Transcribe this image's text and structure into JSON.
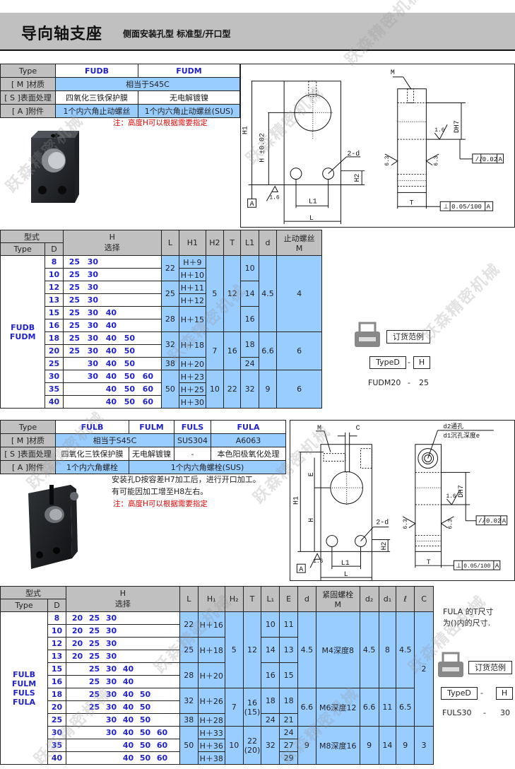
{
  "header": {
    "title": "导向轴支座",
    "subtitle": "侧面安装孔型 标准型/开口型"
  },
  "section1": {
    "spec": {
      "type_label": "Type",
      "types": [
        "FUDB",
        "FUDM"
      ],
      "material_label": "[ M ]材质",
      "material": "相当于S45C",
      "surface_label": "[ S ]表面处理",
      "surface": [
        "四氧化三铁保护膜",
        "无电解镀镍"
      ],
      "accessory_label": "[ A ]附件",
      "accessory": [
        "1个内六角止动螺丝",
        "1个内六角止动螺丝(SUS)"
      ]
    },
    "note_red": "注：高度H可以根据需要指定",
    "drawing_labels": {
      "H1": "H1",
      "H": "H ±0.02",
      "d2": "2-d",
      "H2": "H2",
      "L1": "L1",
      "L": "L",
      "A": "A",
      "M": "M",
      "DH7": "DH7",
      "T": "T",
      "r16": "1.6",
      "r63": "6.3",
      "parallel": "0.02",
      "perp": "0.05/100"
    },
    "table": {
      "headers": {
        "model": "型式",
        "type": "Type",
        "d": "D",
        "h": "H",
        "h_sub": "选择",
        "L": "L",
        "H1": "H1",
        "H2": "H2",
        "T": "T",
        "L1": "L1",
        "dcol": "d",
        "m": "止动螺丝",
        "m_sub": "M"
      },
      "type_names": [
        "FUDB",
        "FUDM"
      ],
      "rows": [
        {
          "D": "8",
          "H": [
            "25",
            "30",
            "",
            "",
            ""
          ]
        },
        {
          "D": "10",
          "H": [
            "25",
            "30",
            "",
            "",
            ""
          ]
        },
        {
          "D": "12",
          "H": [
            "25",
            "30",
            "",
            "",
            ""
          ]
        },
        {
          "D": "13",
          "H": [
            "25",
            "30",
            "",
            "",
            ""
          ]
        },
        {
          "D": "15",
          "H": [
            "25",
            "30",
            "40",
            "",
            ""
          ]
        },
        {
          "D": "16",
          "H": [
            "25",
            "30",
            "40",
            "",
            ""
          ]
        },
        {
          "D": "18",
          "H": [
            "25",
            "30",
            "40",
            "50",
            ""
          ]
        },
        {
          "D": "20",
          "H": [
            "25",
            "30",
            "40",
            "50",
            ""
          ]
        },
        {
          "D": "25",
          "H": [
            "",
            "30",
            "40",
            "50",
            ""
          ]
        },
        {
          "D": "30",
          "H": [
            "",
            "30",
            "40",
            "50",
            "60"
          ]
        },
        {
          "D": "35",
          "H": [
            "",
            "",
            "40",
            "50",
            "60"
          ]
        },
        {
          "D": "40",
          "H": [
            "",
            "",
            "40",
            "50",
            "60"
          ]
        }
      ],
      "L": [
        "22",
        "25",
        "28",
        "32",
        "38",
        "50"
      ],
      "H1": [
        "H＋9",
        "H＋10",
        "H＋11",
        "H＋12",
        "H＋15",
        "H＋18",
        "H＋20",
        "H＋23",
        "H＋25",
        "H＋30"
      ],
      "H2": [
        "5",
        "7",
        "10"
      ],
      "T": [
        "12",
        "16",
        "22"
      ],
      "L1": [
        "10",
        "14",
        "16",
        "18",
        "24",
        "32"
      ],
      "d": [
        "4.5",
        "6.6",
        "9"
      ],
      "M": [
        "4",
        "6",
        "6"
      ]
    },
    "order": {
      "title": "订货范例",
      "box1": "TypeD",
      "dash": "-",
      "box2": "H",
      "example_code": "FUDM20",
      "example_dash": "-",
      "example_h": "25"
    }
  },
  "section2": {
    "spec": {
      "type_label": "Type",
      "types": [
        "FULB",
        "FULM",
        "FULS",
        "FULA"
      ],
      "material_label": "[ M ]材质",
      "material": [
        "相当于S45C",
        "SUS304",
        "A6063"
      ],
      "surface_label": "[ S ]表面处理",
      "surface": [
        "四氧化三铁保护膜",
        "无电解镀镍",
        "-",
        "本色阳极氧化处理"
      ],
      "accessory_label": "[ A ]附件",
      "accessory": [
        "1个内六角螺栓",
        "1个内六角螺栓(SUS)"
      ]
    },
    "note_lines": [
      "安装孔D按容差H7加工后，进行开口加工。",
      "有可能因加工增至H8左右。"
    ],
    "note_red": "注：高度H可以根据需要指定",
    "drawing_labels": {
      "M": "M",
      "C": "C",
      "E": "E",
      "H1": "H1",
      "H": "H",
      "d2": "2-d",
      "H2": "H2",
      "L1": "L1",
      "L": "L",
      "A": "A",
      "hole1": "d2通孔",
      "hole2": "d1沉孔深度e",
      "DH7": "DH7",
      "T": "T",
      "r16": "1.6",
      "r63": "6.3",
      "parallel": "0.02",
      "perp": "0.05/100"
    },
    "table": {
      "headers": {
        "model": "型式",
        "type": "Type",
        "d": "D",
        "h": "H",
        "h_sub": "选择",
        "L": "L",
        "H1": "H₁",
        "H2": "H₂",
        "T": "T",
        "L1": "L₁",
        "E": "E",
        "dcol": "d",
        "m": "紧固螺栓",
        "m_sub": "M",
        "d2": "d₂",
        "d1": "d₁",
        "l": "ℓ",
        "C": "C"
      },
      "type_names": [
        "FULB",
        "FULM",
        "FULS",
        "FULA"
      ],
      "rows": [
        {
          "D": "8",
          "H": [
            "20",
            "25",
            "30",
            "",
            "",
            ""
          ]
        },
        {
          "D": "10",
          "H": [
            "20",
            "25",
            "30",
            "",
            "",
            ""
          ]
        },
        {
          "D": "12",
          "H": [
            "20",
            "25",
            "30",
            "",
            "",
            ""
          ]
        },
        {
          "D": "13",
          "H": [
            "20",
            "25",
            "30",
            "",
            "",
            ""
          ]
        },
        {
          "D": "15",
          "H": [
            "",
            "25",
            "30",
            "40",
            "",
            ""
          ]
        },
        {
          "D": "16",
          "H": [
            "",
            "25",
            "30",
            "40",
            "",
            ""
          ]
        },
        {
          "D": "18",
          "H": [
            "",
            "25",
            "30",
            "40",
            "50",
            ""
          ]
        },
        {
          "D": "20",
          "H": [
            "",
            "25",
            "30",
            "40",
            "50",
            ""
          ]
        },
        {
          "D": "25",
          "H": [
            "",
            "",
            "30",
            "40",
            "50",
            ""
          ]
        },
        {
          "D": "30",
          "H": [
            "",
            "",
            "30",
            "40",
            "50",
            "60"
          ]
        },
        {
          "D": "35",
          "H": [
            "",
            "",
            "",
            "40",
            "50",
            "60"
          ]
        },
        {
          "D": "40",
          "H": [
            "",
            "",
            "",
            "40",
            "50",
            "60"
          ]
        }
      ],
      "L": [
        "22",
        "25",
        "28",
        "32",
        "38",
        "50"
      ],
      "H1": [
        "H＋16",
        "H＋18",
        "H＋20",
        "H＋26",
        "H＋28",
        "H＋33",
        "H＋36",
        "H＋38"
      ],
      "H2": [
        "5",
        "7",
        "10"
      ],
      "T": [
        "12",
        "16",
        "(15)",
        "22",
        "(20)"
      ],
      "L1": [
        "10",
        "14",
        "16",
        "18",
        "24",
        "32"
      ],
      "E": [
        "11",
        "13",
        "15",
        "18",
        "21",
        "24",
        "27",
        "29"
      ],
      "d": [
        "4.5",
        "6.6",
        "9"
      ],
      "M": [
        "M4深度8",
        "M6深度12",
        "M8深度16"
      ],
      "d2": [
        "4.5",
        "6.6",
        "9"
      ],
      "d1": [
        "8",
        "11",
        "14"
      ],
      "l": [
        "4.5",
        "6.5",
        "9"
      ],
      "C": [
        "2",
        "3"
      ]
    },
    "side_note": [
      "FULA 的T尺寸",
      "为()内的尺寸."
    ],
    "order": {
      "title": "订货范例",
      "box1": "TypeD",
      "dash": "-",
      "box2": "H",
      "example_code": "FULS30",
      "example_dash": "-",
      "example_h": "30"
    }
  },
  "watermark": "跃森精密机械",
  "colors": {
    "header_bg": "#c0c0c0",
    "cell_blue": "#99ccff",
    "type_blue": "#2222cc",
    "note_red": "#e00000"
  }
}
